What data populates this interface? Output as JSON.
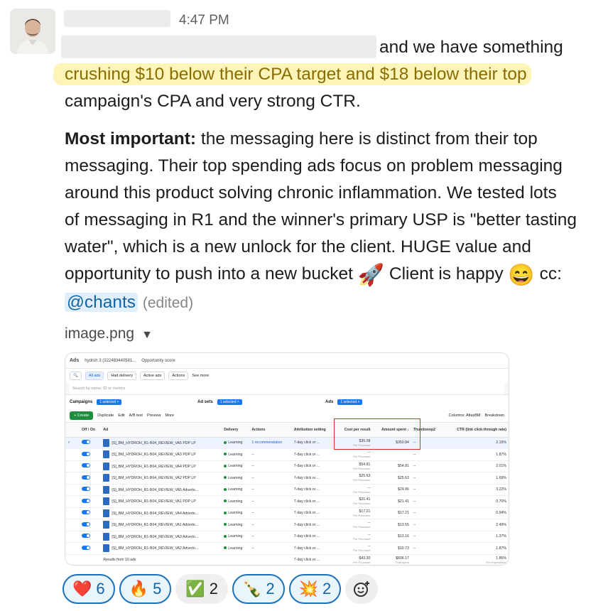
{
  "message": {
    "timestamp": "4:47 PM",
    "line1_tail": "and we have something",
    "highlight": "crushing $10 below their CPA target and $18 below their top",
    "line3": "campaign's CPA and very strong CTR.",
    "bold_lead": "Most important:",
    "p2_l1": "the messaging here is distinct from their top",
    "p2_l2": "messaging. Their top spending ads focus on problem messaging",
    "p2_l3": "around this product solving chronic inflammation. We tested lots",
    "p2_l4": "of messaging in R1 and the winner's primary USP is \"better tasting",
    "p2_l5": "water\", which is a new unlock for the client. HUGE value and",
    "p2_l6_a": "opportunity to push into a new bucket",
    "p2_l6_rocket": "🚀",
    "p2_l6_b": "Client is happy",
    "p2_l6_smile": "😄",
    "p2_l6_c": "cc:",
    "mention": "@chants",
    "edited": "(edited)"
  },
  "attachment": {
    "filename": "image.png",
    "caret": "▼"
  },
  "ads_manager": {
    "brand": "Ads",
    "account": "hydroh 3 (322483440581...",
    "opportunity": "Opportunity score",
    "filters": [
      "All ads",
      "Had delivery",
      "Active ads",
      "Actions",
      "See more"
    ],
    "search_placeholder": "Search by name, ID or metrics",
    "tabs": [
      {
        "label": "Campaigns",
        "pill": "1 selected ×"
      },
      {
        "label": "Ad sets",
        "pill": "1 selected ×"
      },
      {
        "label": "Ads",
        "pill": "1 selected ×"
      }
    ],
    "toolbar": {
      "create": "+ Create",
      "duplicate": "Duplicate",
      "edit": "Edit",
      "ab": "A/B test",
      "preview": "Preview",
      "more": "More",
      "columns": "Columns: AtlasBM",
      "breakdown": "Breakdown"
    },
    "headers": [
      "Off / On",
      "Ad",
      "Delivery",
      "Actions",
      "Attribution setting",
      "Cost per result",
      "Amount spent ↓",
      "Thumbstop2",
      "CTR (link click-through rate)"
    ],
    "rows": [
      {
        "ad": "[S]_BM_HYDROH_R1-B04_REVIEW_VA5 PDP LP",
        "delivery": "Learning",
        "actions": "1 recommendation",
        "attr": "7-day click or ...",
        "cpr": "$35.08",
        "cpr_sub": "Per Purchase",
        "spent": "$350.84",
        "thumb": "--",
        "ctr": "2.15%"
      },
      {
        "ad": "[S]_BM_HYDROH_R1-B04_REVIEW_VA3 PDP LP",
        "delivery": "Learning",
        "actions": "--",
        "attr": "7-day click or ...",
        "cpr": "--",
        "cpr_sub": "Per Purchase",
        "spent": "",
        "thumb": "--",
        "ctr": "1.87%"
      },
      {
        "ad": "[S]_BM_HYDROH_R1-B04_REVIEW_VA4 PDP LP",
        "delivery": "Learning",
        "actions": "--",
        "attr": "7-day click or ...",
        "cpr": "$54.81",
        "cpr_sub": "Per Purchase",
        "spent": "$54.81",
        "thumb": "--",
        "ctr": "2.01%"
      },
      {
        "ad": "[S]_BM_HYDROH_R1-B04_REVIEW_VA2 PDP LP",
        "delivery": "Learning",
        "actions": "--",
        "attr": "7-day click or ...",
        "cpr": "$25.63",
        "cpr_sub": "Per Purchase",
        "spent": "$25.63",
        "thumb": "--",
        "ctr": "1.69%"
      },
      {
        "ad": "[S]_BM_HYDROH_R1-B04_REVIEW_VA5 Adverto...",
        "delivery": "Learning",
        "actions": "--",
        "attr": "7-day click or ...",
        "cpr": "--",
        "cpr_sub": "Per Purchase",
        "spent": "$24.86",
        "thumb": "--",
        "ctr": "3.22%"
      },
      {
        "ad": "[S]_BM_HYDROH_R1-B04_REVIEW_VA1 PDP LP",
        "delivery": "Learning",
        "actions": "--",
        "attr": "7-day click or ...",
        "cpr": "$21.41",
        "cpr_sub": "Per Purchase",
        "spent": "$21.41",
        "thumb": "--",
        "ctr": "0.70%"
      },
      {
        "ad": "[S]_BM_HYDROH_R1-B04_REVIEW_VA4 Adverto...",
        "delivery": "Learning",
        "actions": "--",
        "attr": "7-day click or ...",
        "cpr": "$17.21",
        "cpr_sub": "Per Purchase",
        "spent": "$17.21",
        "thumb": "--",
        "ctr": "0.94%"
      },
      {
        "ad": "[S]_BM_HYDROH_R1-B04_REVIEW_VA1 Adverto...",
        "delivery": "Learning",
        "actions": "--",
        "attr": "7-day click or ...",
        "cpr": "--",
        "cpr_sub": "Per Purchase",
        "spent": "$13.55",
        "thumb": "--",
        "ctr": "2.49%"
      },
      {
        "ad": "[S]_BM_HYDROH_R1-B04_REVIEW_VA3 Adverto...",
        "delivery": "Learning",
        "actions": "--",
        "attr": "7-day click or ...",
        "cpr": "--",
        "cpr_sub": "Per Purchase",
        "spent": "$13.16",
        "thumb": "--",
        "ctr": "1.37%"
      },
      {
        "ad": "[S]_BM_HYDROH_R1-B04_REVIEW_VA2 Adverto...",
        "delivery": "Learning",
        "actions": "--",
        "attr": "7-day click or ...",
        "cpr": "--",
        "cpr_sub": "Per Purchase",
        "spent": "$10.73",
        "thumb": "--",
        "ctr": "1.87%"
      }
    ],
    "footer": {
      "label": "Results from 10 ads",
      "attr": "7-day click or ...",
      "cpr": "$43.30",
      "cpr_sub": "Per Purchase",
      "spent": "$606.17",
      "spent_sub": "Total spent",
      "ctr": "1.86%",
      "ctr_sub": "Per impressions"
    }
  },
  "reactions": [
    {
      "emoji": "❤️",
      "count": "6",
      "active": true
    },
    {
      "emoji": "🔥",
      "count": "5",
      "active": true
    },
    {
      "emoji": "✅",
      "count": "2",
      "active": false
    },
    {
      "emoji": "🍾",
      "count": "2",
      "active": true
    },
    {
      "emoji": "💥",
      "count": "2",
      "active": true
    }
  ],
  "add_reaction_icon": "add-reaction-icon"
}
